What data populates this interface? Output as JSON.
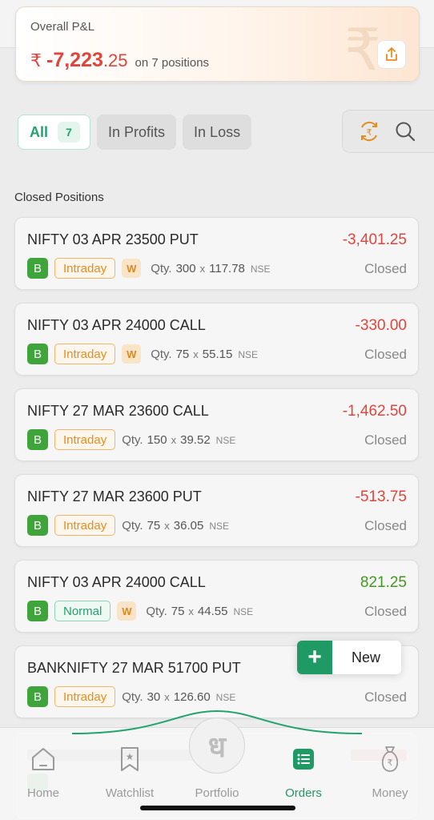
{
  "summary": {
    "title": "Overall P&L",
    "currency": "₹",
    "amount_main": "-7,223",
    "amount_decimal": ".25",
    "positions_text": "on 7 positions"
  },
  "filters": {
    "all_label": "All",
    "all_count": "7",
    "profits_label": "In Profits",
    "loss_label": "In Loss"
  },
  "section_title": "Closed Positions",
  "positions": [
    {
      "name": "NIFTY 03 APR 23500 PUT",
      "pnl": "-3,401.25",
      "side": "B",
      "type": "Intraday",
      "weekly": "W",
      "qty_label": "Qty.",
      "qty": "300",
      "x": "x",
      "price": "117.78",
      "exchange": "NSE",
      "status": "Closed"
    },
    {
      "name": "NIFTY 03 APR 24000 CALL",
      "pnl": "-330.00",
      "side": "B",
      "type": "Intraday",
      "weekly": "W",
      "qty_label": "Qty.",
      "qty": "75",
      "x": "x",
      "price": "55.15",
      "exchange": "NSE",
      "status": "Closed"
    },
    {
      "name": "NIFTY 27 MAR 23600 CALL",
      "pnl": "-1,462.50",
      "side": "B",
      "type": "Intraday",
      "qty_label": "Qty.",
      "qty": "150",
      "x": "x",
      "price": "39.52",
      "exchange": "NSE",
      "status": "Closed"
    },
    {
      "name": "NIFTY 27 MAR 23600 PUT",
      "pnl": "-513.75",
      "side": "B",
      "type": "Intraday",
      "qty_label": "Qty.",
      "qty": "75",
      "x": "x",
      "price": "36.05",
      "exchange": "NSE",
      "status": "Closed"
    },
    {
      "name": "NIFTY 03 APR 24000 CALL",
      "pnl": "821.25",
      "side": "B",
      "type": "Normal",
      "weekly": "W",
      "qty_label": "Qty.",
      "qty": "75",
      "x": "x",
      "price": "44.55",
      "exchange": "NSE",
      "status": "Closed"
    },
    {
      "name": "BANKNIFTY 27 MAR 51700 PUT",
      "pnl": "",
      "side": "B",
      "type": "Intraday",
      "qty_label": "Qty.",
      "qty": "30",
      "x": "x",
      "price": "126.60",
      "exchange": "NSE",
      "status": "Closed"
    }
  ],
  "fab": {
    "label": "New"
  },
  "nav": {
    "home": "Home",
    "watchlist": "Watchlist",
    "portfolio": "Portfolio",
    "orders": "Orders",
    "money": "Money",
    "center_glyph": "ध"
  },
  "colors": {
    "loss": "#e0453d",
    "profit": "#3f9a1e",
    "brand": "#1f9a64",
    "intraday": "#e58d1f"
  },
  "icons": [
    "share-icon",
    "exchange-rupee-icon",
    "search-icon",
    "plus-icon",
    "home-icon",
    "watchlist-icon",
    "orders-icon",
    "money-bag-icon"
  ]
}
